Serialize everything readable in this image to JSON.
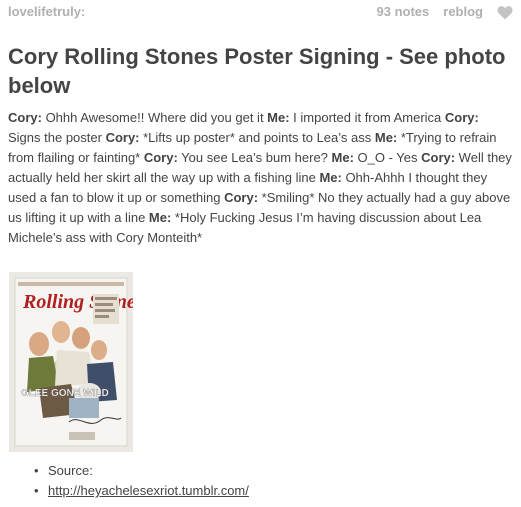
{
  "header": {
    "blog_name": "lovelifetruly:",
    "notes": "93 notes",
    "reblog": "reblog",
    "like_icon": "heart-icon"
  },
  "post": {
    "title": "Cory Rolling Stones Poster Signing - See photo below",
    "dialogue": [
      {
        "speaker": "Cory:",
        "text": " Ohhh Awesome!! Where did you get it "
      },
      {
        "speaker": "Me:",
        "text": " I imported it from America "
      },
      {
        "speaker": "Cory:",
        "text": " Signs the poster "
      },
      {
        "speaker": "Cory:",
        "text": " *Lifts up poster* and points to Lea’s ass "
      },
      {
        "speaker": "Me:",
        "text": " *Trying to refrain from flailing or fainting* "
      },
      {
        "speaker": "Cory:",
        "text": " You see Lea’s bum here? "
      },
      {
        "speaker": "Me:",
        "text": " O_O - Yes "
      },
      {
        "speaker": "Cory:",
        "text": " Well they actually held her skirt all the way up with a fishing line "
      },
      {
        "speaker": "Me:",
        "text": " Ohh-Ahhh I thought they used a fan to blow it up or something "
      },
      {
        "speaker": "Cory:",
        "text": " *Smiling* No they actually had a guy above us lifting it up with a line "
      },
      {
        "speaker": "Me:",
        "text": " *Holy Fucking Jesus I’m having discussion about Lea Michele’s ass with Cory Monteith*"
      }
    ],
    "poster": {
      "masthead": "Rolling Stone",
      "cover_line": "GLEE GONE WILD"
    },
    "source": {
      "label": "Source:",
      "link": "http://heyachelesexriot.tumblr.com/"
    }
  }
}
